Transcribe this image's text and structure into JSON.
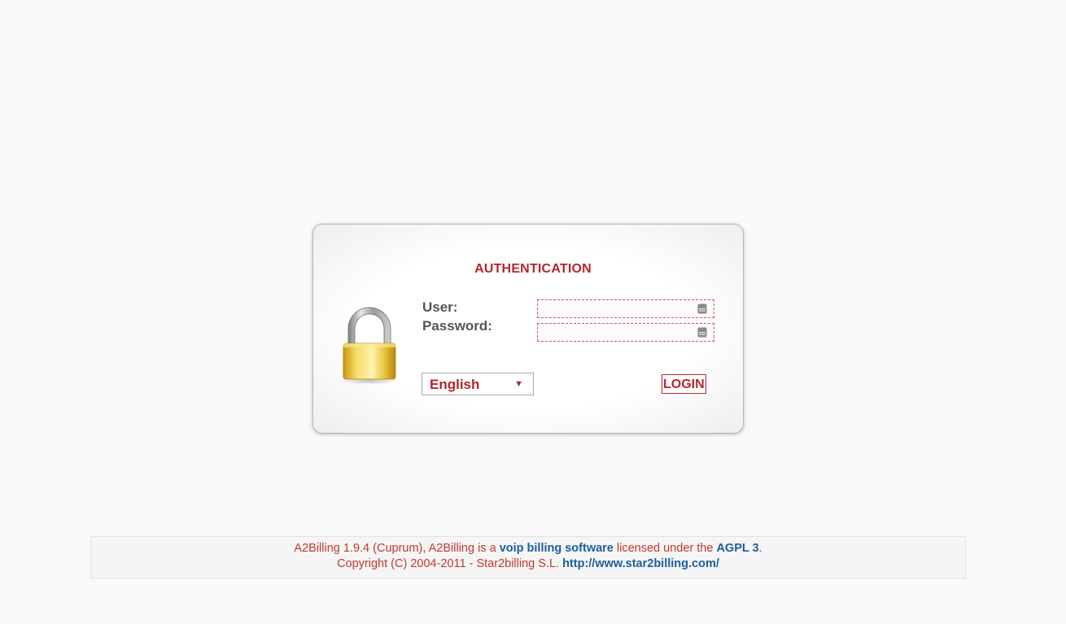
{
  "auth": {
    "title": "AUTHENTICATION",
    "user_label": "User:",
    "password_label": "Password:",
    "user_value": "",
    "password_value": "",
    "language_selected": "English",
    "login_button": "LOGIN"
  },
  "footer": {
    "line1_prefix": "A2Billing 1.9.4 (Cuprum), A2Billing is a ",
    "line1_link1": "voip billing software",
    "line1_mid": " licensed under the ",
    "line1_link2": "AGPL 3",
    "line1_suffix": ".",
    "line2_prefix": "Copyright (C) 2004-2011 - Star2billing S.L. ",
    "line2_link": "http://www.star2billing.com/"
  },
  "colors": {
    "accent_red": "#b3262c",
    "link_blue": "#1b5e9e",
    "background": "#f9f9f9"
  },
  "icons": {
    "lock": "padlock-icon",
    "field_key": "keyboard-icon",
    "select_arrow": "dropdown-arrow-icon"
  }
}
